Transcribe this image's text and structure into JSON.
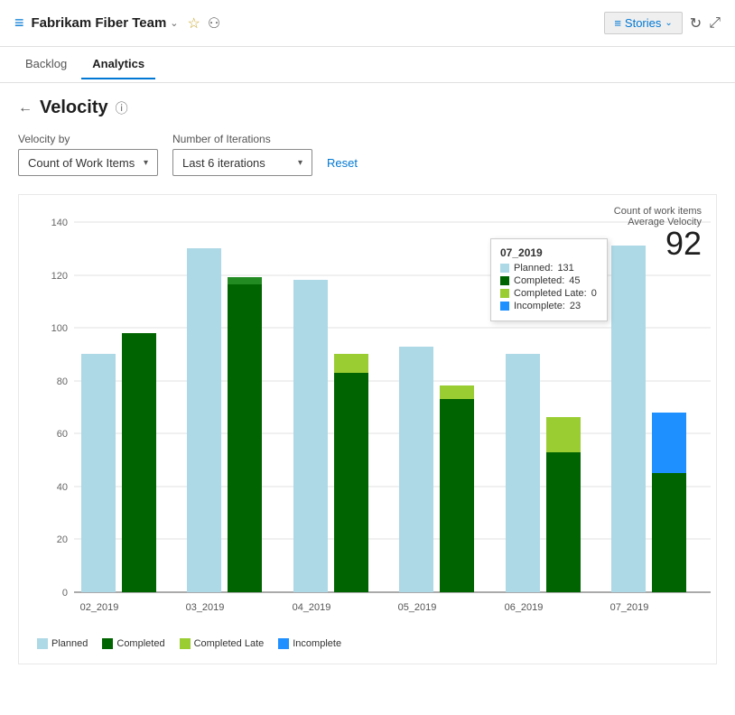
{
  "header": {
    "icon": "≡",
    "team_name": "Fabrikam Fiber Team",
    "chevron": "⌄",
    "star": "☆",
    "people": "👥",
    "stories_label": "Stories",
    "refresh_title": "Refresh",
    "expand_title": "Expand"
  },
  "nav": {
    "tabs": [
      {
        "id": "backlog",
        "label": "Backlog",
        "active": false
      },
      {
        "id": "analytics",
        "label": "Analytics",
        "active": true
      }
    ]
  },
  "page": {
    "back_title": "Back",
    "title": "Velocity",
    "help_title": "Help"
  },
  "filters": {
    "velocity_by_label": "Velocity by",
    "velocity_by_value": "Count of Work Items",
    "iterations_label": "Number of Iterations",
    "iterations_value": "Last 6 iterations",
    "reset_label": "Reset"
  },
  "chart": {
    "velocity_metric_label": "Count of work items",
    "average_velocity_label": "Average Velocity",
    "average_velocity_value": "92",
    "y_axis_max": 140,
    "y_axis_ticks": [
      0,
      20,
      40,
      60,
      80,
      100,
      120,
      140
    ],
    "bars": [
      {
        "sprint": "02_2019",
        "planned": 90,
        "completed": 98,
        "completed_late": 0,
        "incomplete": 0
      },
      {
        "sprint": "03_2019",
        "planned": 130,
        "completed": 119,
        "completed_late": 0,
        "incomplete": 0
      },
      {
        "sprint": "04_2019",
        "planned": 118,
        "completed": 83,
        "completed_late": 7,
        "incomplete": 0
      },
      {
        "sprint": "05_2019",
        "planned": 93,
        "completed": 73,
        "completed_late": 5,
        "incomplete": 0
      },
      {
        "sprint": "06_2019",
        "planned": 90,
        "completed": 53,
        "completed_late": 13,
        "incomplete": 0
      },
      {
        "sprint": "07_2019",
        "planned": 131,
        "completed": 45,
        "completed_late": 0,
        "incomplete": 23
      }
    ],
    "tooltip": {
      "sprint": "07_2019",
      "planned_label": "Planned:",
      "planned_value": "131",
      "completed_label": "Completed:",
      "completed_value": "45",
      "completed_late_label": "Completed Late:",
      "completed_late_value": "0",
      "incomplete_label": "Incomplete:",
      "incomplete_value": "23"
    },
    "legend": [
      {
        "label": "Planned",
        "color": "#add8e6"
      },
      {
        "label": "Completed",
        "color": "#006400"
      },
      {
        "label": "Completed Late",
        "color": "#9acd32"
      },
      {
        "label": "Incomplete",
        "color": "#1e90ff"
      }
    ],
    "colors": {
      "planned": "#add8e6",
      "completed": "#006400",
      "completed_late": "#9acd32",
      "incomplete": "#1e90ff"
    }
  }
}
